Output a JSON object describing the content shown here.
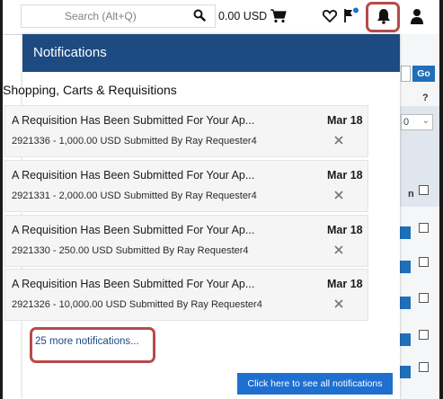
{
  "topbar": {
    "search_placeholder": "Search (Alt+Q)",
    "cart_total": "0.00 USD",
    "icons": [
      "search-icon",
      "cart-icon",
      "heart-icon",
      "flag-icon",
      "bell-icon",
      "user-icon"
    ]
  },
  "panel": {
    "title": "Notifications",
    "category": "Shopping, Carts & Requisitions",
    "items": [
      {
        "title": "A Requisition Has Been Submitted For Your Ap...",
        "date": "Mar 18",
        "subtitle": "2921336 - 1,000.00 USD Submitted By Ray Requester4"
      },
      {
        "title": "A Requisition Has Been Submitted For Your Ap...",
        "date": "Mar 18",
        "subtitle": "2921331 - 2,000.00 USD Submitted By Ray Requester4"
      },
      {
        "title": "A Requisition Has Been Submitted For Your Ap...",
        "date": "Mar 18",
        "subtitle": "2921330 - 250.00 USD Submitted By Ray Requester4"
      },
      {
        "title": "A Requisition Has Been Submitted For Your Ap...",
        "date": "Mar 18",
        "subtitle": "2921326 - 10,000.00 USD Submitted By Ray Requester4"
      }
    ],
    "more_link": "25 more notifications...",
    "see_all_button": "Click here to see all notifications"
  },
  "background": {
    "go_button": "Go",
    "help_mark": "?",
    "select_value": "0",
    "column_letter": "n"
  },
  "colors": {
    "header_blue": "#1d4a80",
    "button_blue": "#1f6fd1",
    "highlight_red": "#b84a4a"
  }
}
